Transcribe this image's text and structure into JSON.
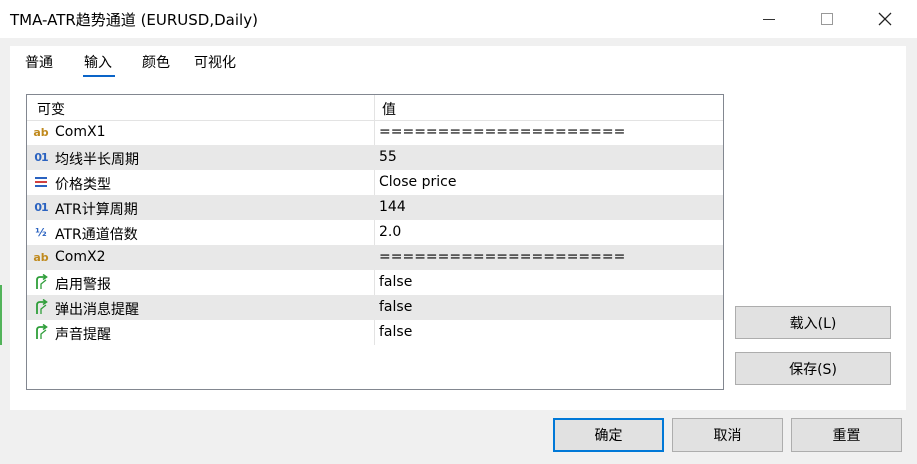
{
  "window": {
    "title": "TMA-ATR趋势通道 (EURUSD,Daily)"
  },
  "tabs": [
    {
      "label": "普通"
    },
    {
      "label": "输入"
    },
    {
      "label": "颜色"
    },
    {
      "label": "可视化"
    }
  ],
  "active_tab": "输入",
  "table": {
    "headers": {
      "variable": "可变",
      "value": "值"
    },
    "rows": [
      {
        "icon": "string-icon",
        "icon_text": "ab",
        "name": "ComX1",
        "value": "====================="
      },
      {
        "icon": "integer-icon",
        "icon_text": "01",
        "name": "均线半长周期",
        "value": "55"
      },
      {
        "icon": "enum-icon",
        "icon_text": "",
        "name": "价格类型",
        "value": "Close price"
      },
      {
        "icon": "integer-icon",
        "icon_text": "01",
        "name": "ATR计算周期",
        "value": "144"
      },
      {
        "icon": "double-icon",
        "icon_text": "½",
        "name": "ATR通道倍数",
        "value": "2.0"
      },
      {
        "icon": "string-icon",
        "icon_text": "ab",
        "name": "ComX2",
        "value": "====================="
      },
      {
        "icon": "bool-icon",
        "icon_text": "",
        "name": "启用警报",
        "value": "false"
      },
      {
        "icon": "bool-icon",
        "icon_text": "",
        "name": "弹出消息提醒",
        "value": "false"
      },
      {
        "icon": "bool-icon",
        "icon_text": "",
        "name": "声音提醒",
        "value": "false"
      }
    ]
  },
  "side_buttons": {
    "load": "载入(L)",
    "save": "保存(S)"
  },
  "footer_buttons": {
    "ok": "确定",
    "cancel": "取消",
    "reset": "重置"
  },
  "colors": {
    "accent": "#0078d7",
    "bool_icon": "#2f9e3a",
    "string_icon": "#c08a1e",
    "number_icon": "#2a62c0"
  }
}
